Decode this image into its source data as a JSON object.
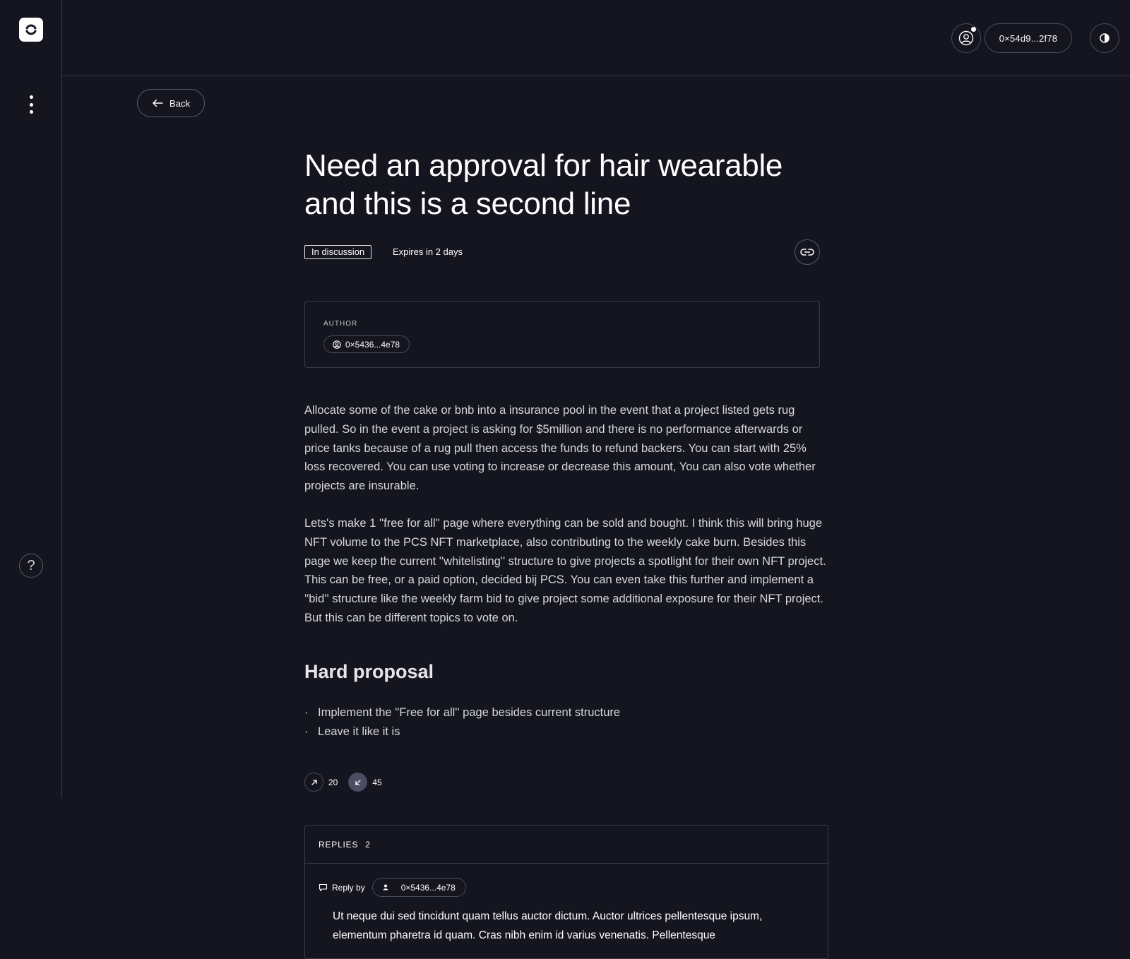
{
  "header": {
    "wallet_address": "0×54d9...2f78"
  },
  "sidebar": {
    "help_label": "?"
  },
  "back_button": {
    "label": "Back"
  },
  "proposal": {
    "title": "Need an approval for hair wearable and this is a second line",
    "status": "In discussion",
    "expires": "Expires in 2 days",
    "author_label": "AUTHOR",
    "author_address": "0×5436...4e78",
    "paragraphs": [
      "Allocate some of the cake or bnb into a insurance pool in the event that a project listed gets rug pulled. So in the event a project is asking for $5million and there is no performance afterwards or price tanks because of a rug pull then access the funds to refund backers. You can start with 25% loss recovered. You can use voting to increase or decrease this amount, You can also vote whether projects are insurable.",
      "Lets's make 1 ''free for all'' page where everything can be sold and bought. I think this will bring huge NFT volume to the PCS NFT marketplace, also contributing to the weekly cake burn. Besides this page we keep the current ''whitelisting'' structure to give projects a spotlight for their own NFT project. This can be free, or a paid option, decided bij PCS. You can even take this further and implement a ''bid'' structure like the weekly farm bid to give project some additional exposure for their NFT project. But this can be different topics to vote on."
    ],
    "section_heading": "Hard proposal",
    "options": [
      "Implement the ''Free for all'' page besides current structure",
      "Leave it like it is"
    ],
    "upvotes": "20",
    "downvotes": "45"
  },
  "replies": {
    "label": "REPLIES",
    "count": "2",
    "items": [
      {
        "reply_by_label": "Reply by",
        "author": "0×5436...4e78",
        "text": "Ut neque dui sed tincidunt quam tellus auctor dictum. Auctor ultrices pellentesque ipsum, elementum pharetra id quam. Cras nibh enim id varius venenatis. Pellentesque"
      }
    ]
  }
}
